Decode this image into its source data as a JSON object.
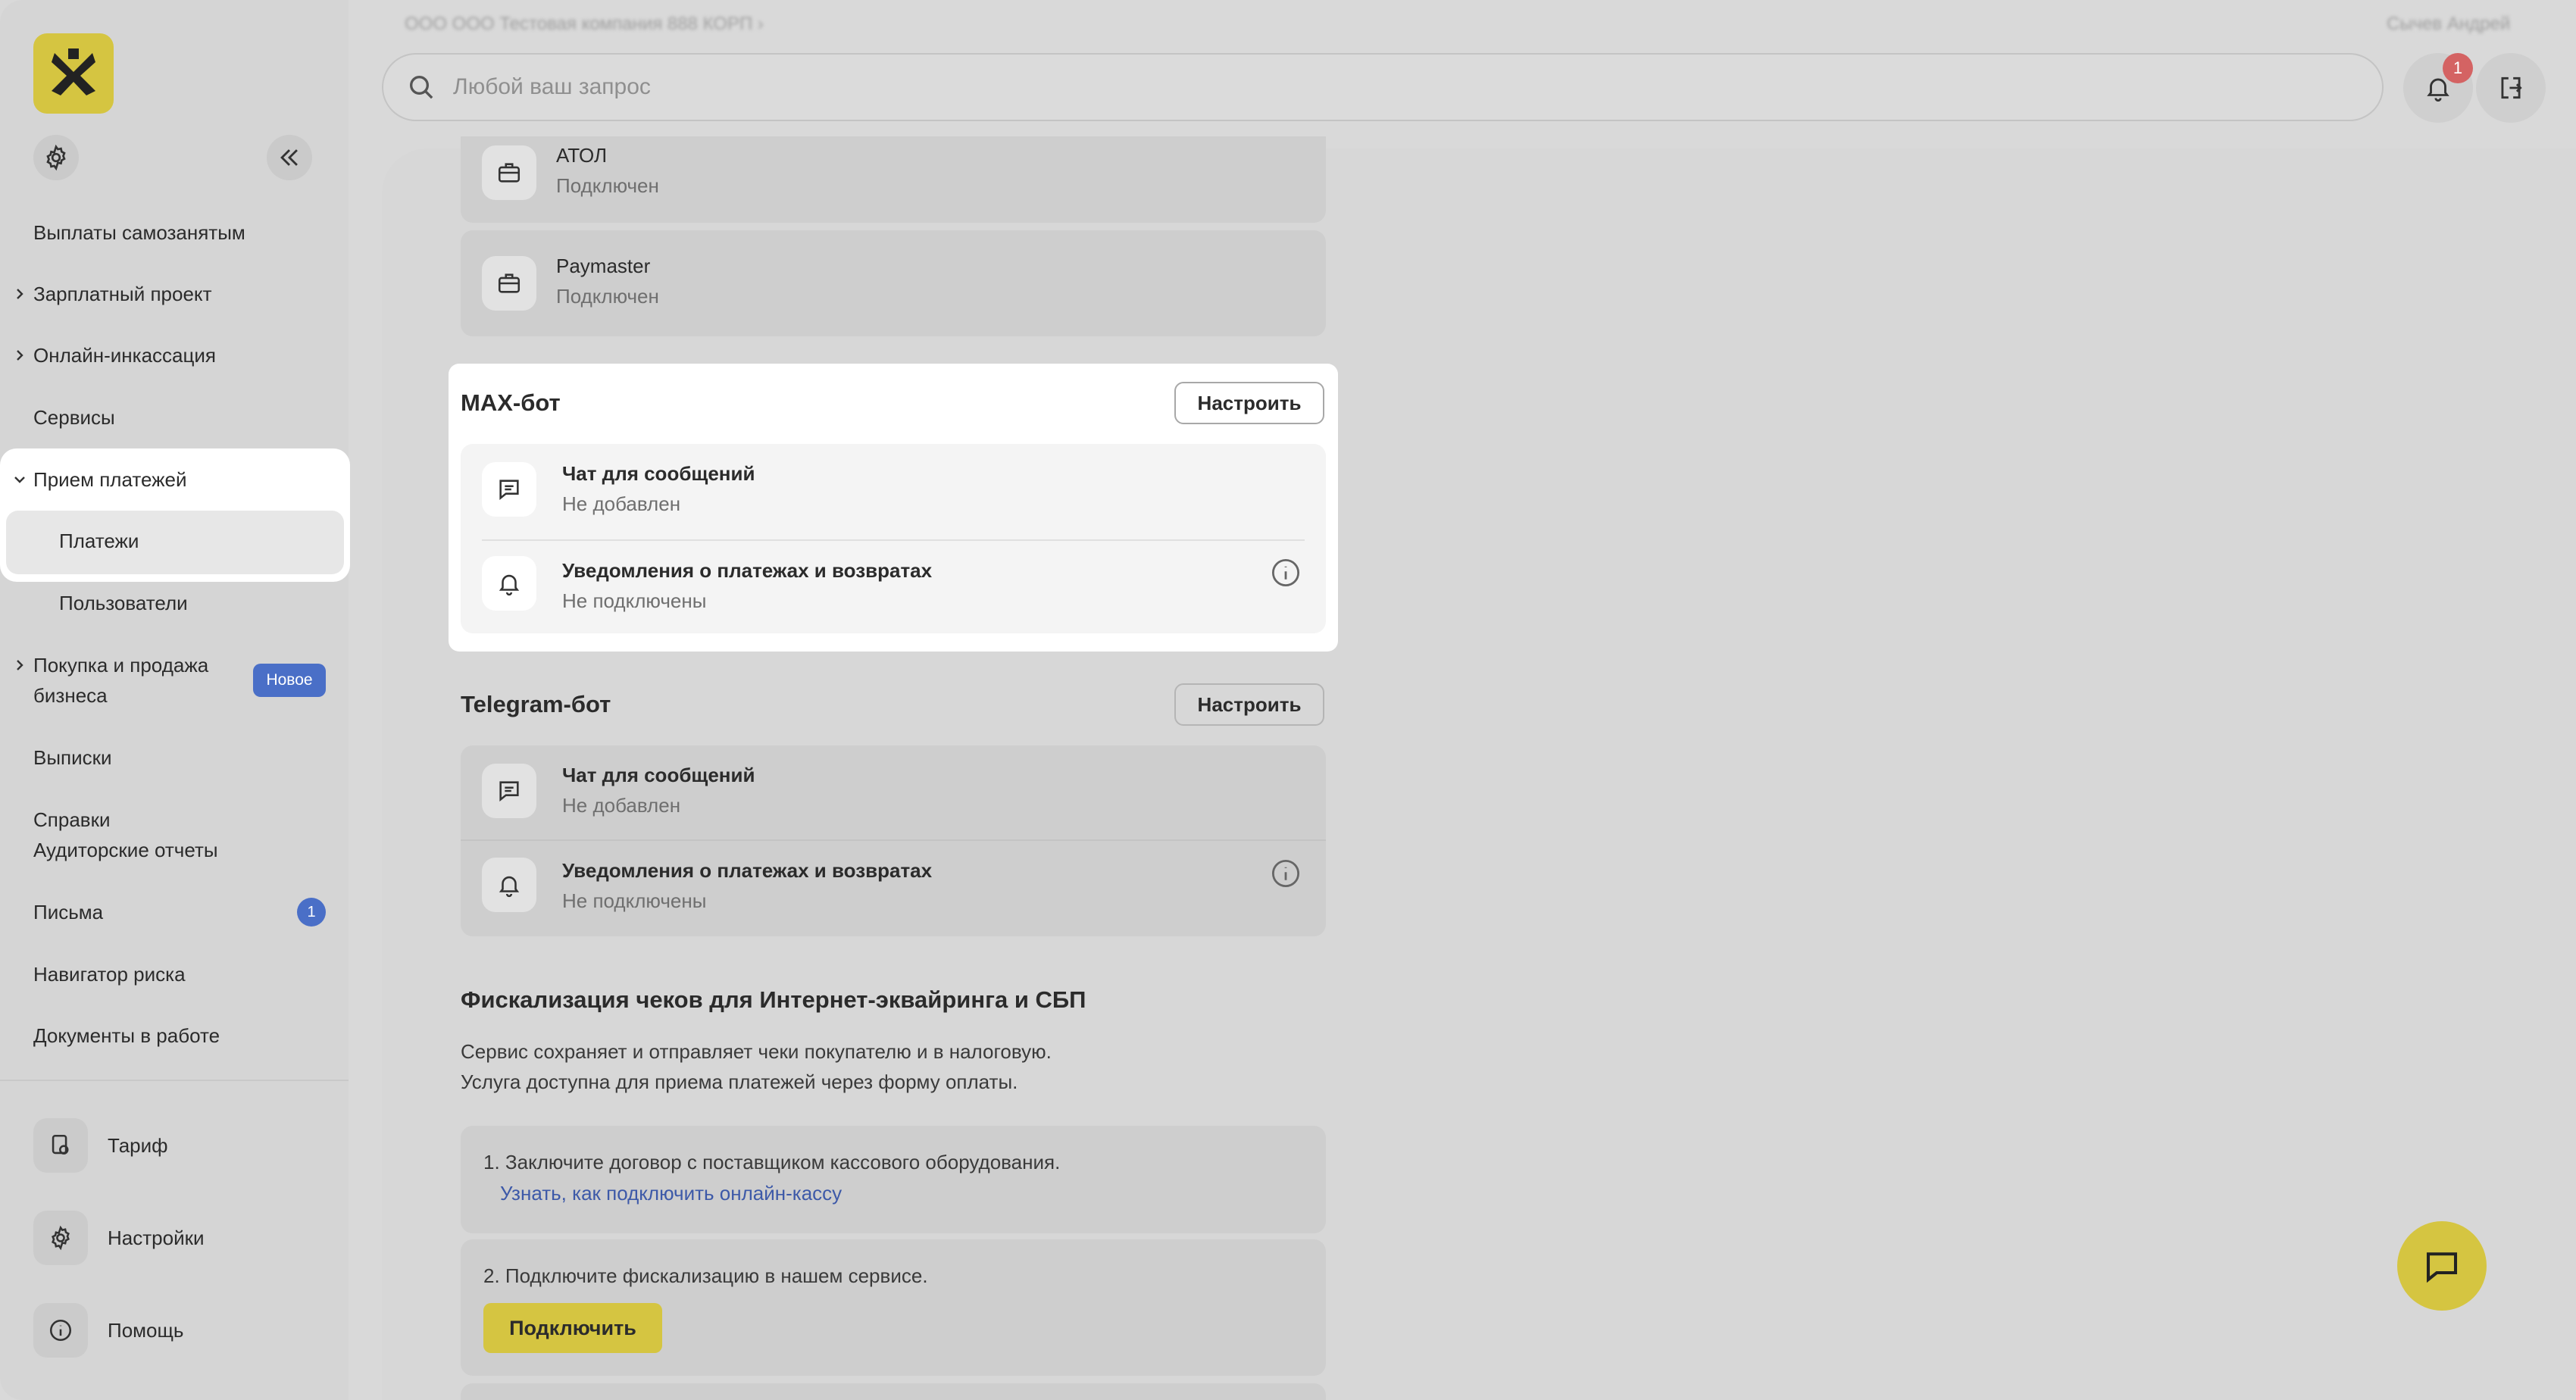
{
  "header": {
    "breadcrumb": "ООО ООО Тестовая компания 888 КОРП",
    "user_name": "Сычев Андрей",
    "search_placeholder": "Любой ваш запрос",
    "notification_count": "1"
  },
  "sidebar": {
    "items": [
      {
        "label": "Выплаты самозанятым"
      },
      {
        "label": "Зарплатный проект"
      },
      {
        "label": "Онлайн-инкассация"
      },
      {
        "label": "Сервисы"
      },
      {
        "label": "Прием платежей"
      },
      {
        "label": "Платежи"
      },
      {
        "label": "Пользователи"
      },
      {
        "label": "Покупка и продажа"
      },
      {
        "label": "бизнеса"
      },
      {
        "label": "Выписки"
      },
      {
        "label": "Справки"
      },
      {
        "label": "Аудиторские отчеты"
      },
      {
        "label": "Письма"
      },
      {
        "label": "Навигатор риска"
      },
      {
        "label": "Документы в работе"
      }
    ],
    "new_badge": "Новое",
    "letters_count": "1",
    "bottom": [
      {
        "label": "Тариф"
      },
      {
        "label": "Настройки"
      },
      {
        "label": "Помощь"
      }
    ]
  },
  "main": {
    "cash_registers": [
      {
        "name": "АТОЛ",
        "status": "Подключен"
      },
      {
        "name": "Paymaster",
        "status": "Подключен"
      }
    ],
    "max_bot": {
      "title": "MAX-бот",
      "button": "Настроить",
      "rows": [
        {
          "title": "Чат для сообщений",
          "status": "Не добавлен"
        },
        {
          "title": "Уведомления о платежах и возвратах",
          "status": "Не подключены"
        }
      ]
    },
    "telegram_bot": {
      "title": "Telegram-бот",
      "button": "Настроить",
      "rows": [
        {
          "title": "Чат для сообщений",
          "status": "Не добавлен"
        },
        {
          "title": "Уведомления о платежах и возвратах",
          "status": "Не подключены"
        }
      ]
    },
    "fiscal": {
      "title": "Фискализация чеков для Интернет-эквайринга и СБП",
      "desc_line1": "Сервис сохраняет и отправляет чеки покупателю и в налоговую.",
      "desc_line2": "Услуга доступна для приема платежей через форму оплаты.",
      "step1": "1. Заключите договор с поставщиком кассового оборудования.",
      "step1_link": "Узнать, как подключить онлайн-кассу",
      "step2": "2. Подключите фискализацию в нашем сервисе.",
      "step2_button": "Подключить"
    }
  },
  "colors": {
    "brand_yellow": "#d5c541",
    "accent_blue": "#4a6fc7",
    "link_blue": "#3d59a8",
    "notification_red": "#d46363"
  }
}
